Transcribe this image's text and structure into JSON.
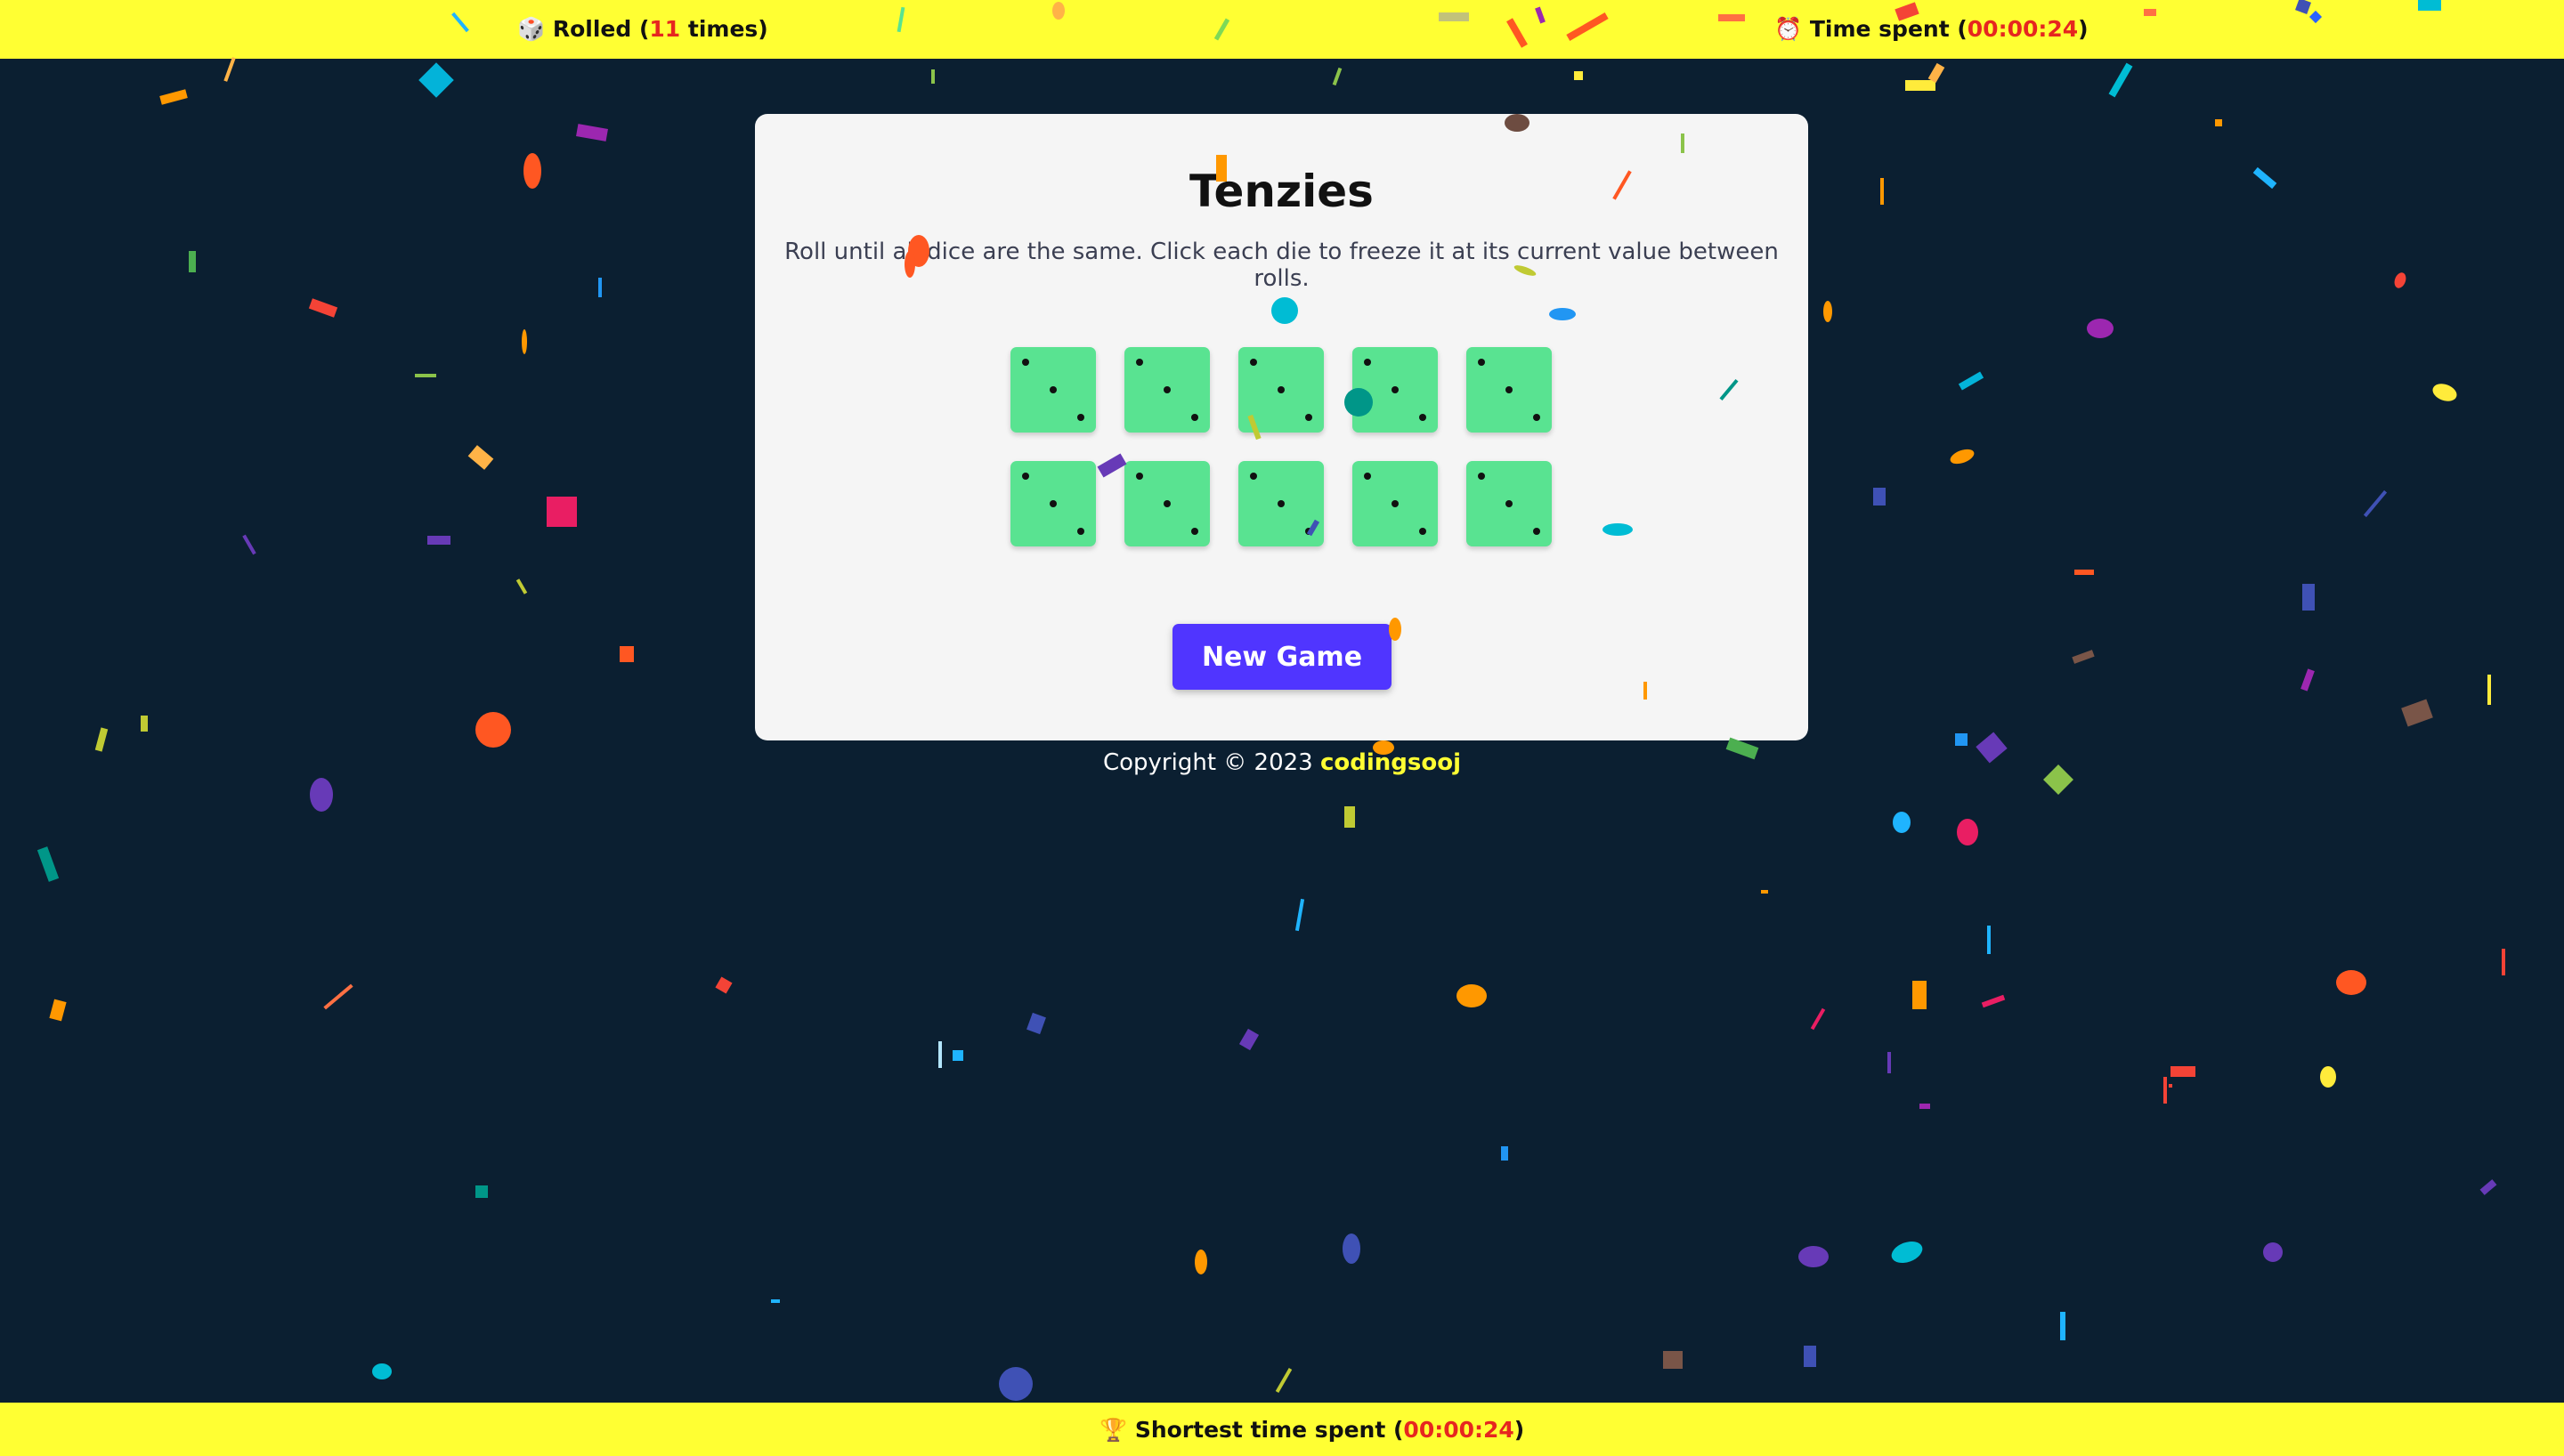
{
  "stats": {
    "rolls_prefix": "🎲 Rolled (",
    "rolls_count": "11",
    "rolls_suffix": " times)",
    "time_prefix": "⏰ Time spent (",
    "time_value": "00:00:24",
    "time_suffix": ")",
    "best_prefix": "🏆 Shortest time spent (",
    "best_value": "00:00:24",
    "best_suffix": ")"
  },
  "game": {
    "title": "Tenzies",
    "instructions": "Roll until all dice are the same. Click each die to freeze it at its current value between rolls.",
    "dice_values": [
      3,
      3,
      3,
      3,
      3,
      3,
      3,
      3,
      3,
      3
    ],
    "new_game_label": "New Game"
  },
  "footer": {
    "copyright_prefix": "Copyright © 2023 ",
    "author": "codingsooj"
  },
  "colors": {
    "accent_bar": "#ffff33",
    "background": "#0b1f31",
    "die": "#59e391",
    "button": "#5035ff",
    "highlight_number": "#e6261f"
  }
}
